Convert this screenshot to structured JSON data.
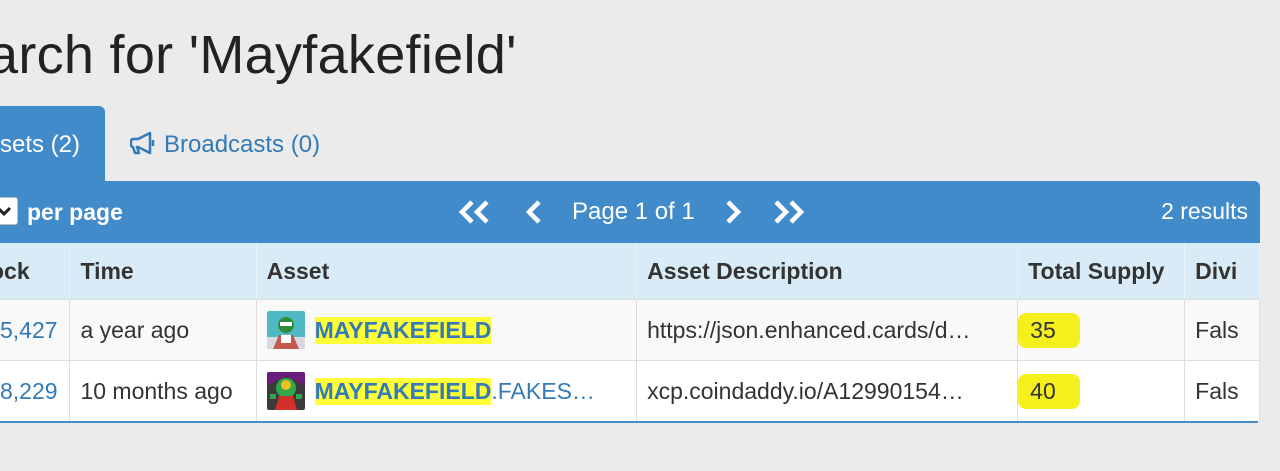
{
  "page": {
    "title": "arch for 'Mayfakefield'"
  },
  "tabs": [
    {
      "label": "sets (2)",
      "active": true
    },
    {
      "label": "Broadcasts (0)",
      "icon": "bullhorn-icon",
      "active": false
    }
  ],
  "toolbar": {
    "per_page_label": "per page",
    "page_text": "Page 1 of 1",
    "results_text": "2 results"
  },
  "table": {
    "headers": [
      "ock",
      "Time",
      "Asset",
      "Asset Description",
      "Total Supply",
      "Divi"
    ],
    "rows": [
      {
        "block": "5,427",
        "time": "a year ago",
        "asset_highlight": "MAYFAKEFIELD",
        "asset_rest": "",
        "description": "https://json.enhanced.cards/d…",
        "supply": "35",
        "divisible": "Fals"
      },
      {
        "block": "8,229",
        "time": "10 months ago",
        "asset_highlight": "MAYFAKEFIELD",
        "asset_rest": ".FAKES…",
        "description": "xcp.coindaddy.io/A12990154…",
        "supply": "40",
        "divisible": "Fals"
      }
    ]
  },
  "colors": {
    "primary": "#428bca",
    "link": "#337ab7",
    "highlight": "#ffff37",
    "header_bg": "#d9ebf6"
  }
}
